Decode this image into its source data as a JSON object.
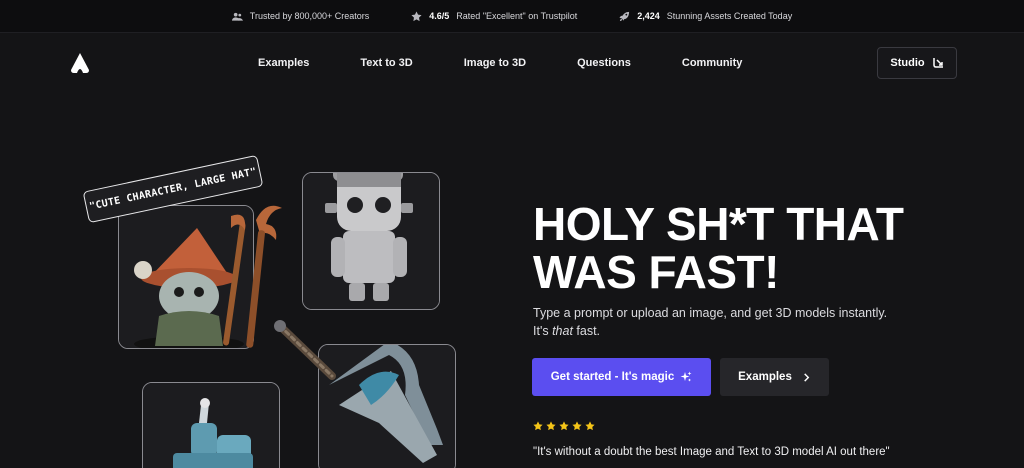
{
  "topbar": {
    "stat1": {
      "bold": "",
      "text": "Trusted by 800,000+ Creators",
      "icon": "users-icon"
    },
    "stat2": {
      "bold": "4.6/5",
      "text": "Rated \"Excellent\" on Trustpilot",
      "icon": "star-icon"
    },
    "stat3": {
      "bold": "2,424",
      "text": "Stunning Assets Created Today",
      "icon": "rocket-icon"
    }
  },
  "nav": {
    "links": [
      "Examples",
      "Text to 3D",
      "Image to 3D",
      "Questions",
      "Community"
    ],
    "studio_label": "Studio"
  },
  "hero": {
    "title_line1": "HOLY SH*T THAT",
    "title_line2": "WAS FAST!",
    "sub_line1": "Type a prompt or upload an image, and get 3D models instantly.",
    "sub_line2_pre": "It's ",
    "sub_line2_em": "that",
    "sub_line2_post": " fast.",
    "primary_button": "Get started - It's magic",
    "secondary_button": "Examples",
    "rating_stars": 5,
    "quote": "\"It's without a doubt the best Image and Text to 3D model AI out there\""
  },
  "showcase": {
    "prompt_tag": "\"CUTE CHARACTER, LARGE HAT\""
  },
  "colors": {
    "accent": "#5b4ef0",
    "background": "#141416",
    "star": "#f5c518"
  }
}
